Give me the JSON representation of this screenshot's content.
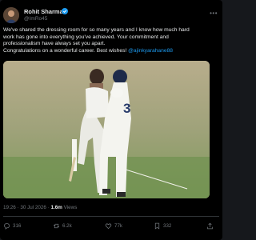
{
  "post": {
    "author_name": "Rohit Sharma",
    "author_handle": "@ImRo45",
    "text_lines": [
      "We've shared the dressing room for so many years and I know how much hard",
      "work has gone into everything you've achieved. Your commitment and",
      "professionalism have always set you apart.",
      "Congratulations on a wonderful career. Best wishes! "
    ],
    "mention": "@ajinkyarahane88",
    "time": "19:26",
    "date": "30 Jul 2026",
    "views_count": "1.6m",
    "views_label": "Views"
  },
  "actions": {
    "reply_count": "316",
    "repost_count": "6.2k",
    "like_count": "77k",
    "bookmark_count": "332"
  },
  "colors": {
    "background": "#000000",
    "text": "#e7e9ea",
    "secondary": "#71767b",
    "accent": "#1d9bf0"
  },
  "icons": [
    "verified-badge-icon",
    "more-icon",
    "reply-icon",
    "repost-icon",
    "like-icon",
    "bookmark-icon",
    "share-icon"
  ]
}
